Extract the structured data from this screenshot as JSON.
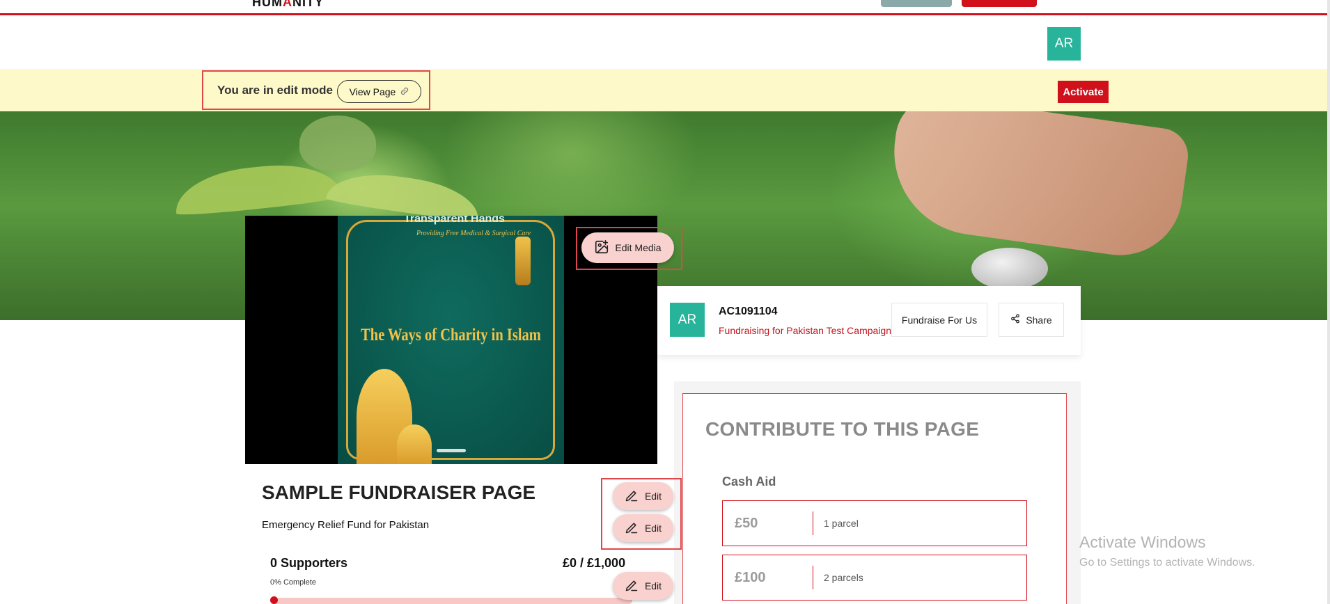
{
  "header": {
    "logo_prefix": "HUM",
    "logo_mark": "A",
    "logo_suffix": "NITY",
    "user_initials": "AR",
    "brand_color": "#d0101a",
    "teal_color": "#27b49a"
  },
  "edit_bar": {
    "message": "You are in edit mode",
    "view_page_label": "View Page",
    "activate_label": "Activate"
  },
  "media": {
    "edit_media_label": "Edit Media",
    "poster_org": "Transparent Hands",
    "poster_tagline": "Providing Free Medical & Surgical Care",
    "poster_title": "The Ways of Charity in Islam"
  },
  "profile": {
    "initials": "AR",
    "account_id": "AC1091104",
    "fundraising_text": "Fundraising for Pakistan Test Campaign",
    "fundraise_button": "Fundraise For Us",
    "share_button": "Share"
  },
  "fundraiser": {
    "title": "SAMPLE FUNDRAISER PAGE",
    "subtitle": "Emergency Relief Fund for Pakistan",
    "supporters": "0 Supporters",
    "raised": "£0 / £1,000",
    "complete": "0% Complete",
    "progress_fraction": 0,
    "edit_label": "Edit"
  },
  "contribute": {
    "title": "CONTRIBUTE TO THIS PAGE",
    "section": "Cash Aid",
    "options": [
      {
        "amount": "£50",
        "quantity": "1 parcel"
      },
      {
        "amount": "£100",
        "quantity": "2 parcels"
      }
    ]
  },
  "watermark": {
    "line1": "Activate Windows",
    "line2": "Go to Settings to activate Windows."
  }
}
